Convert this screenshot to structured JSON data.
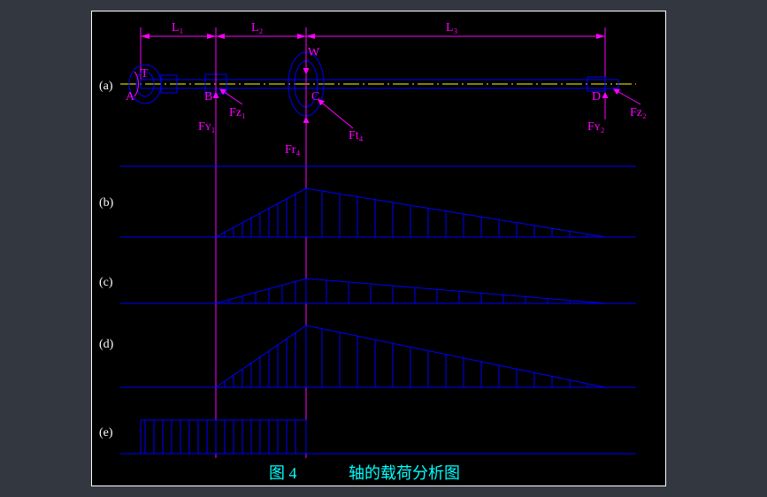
{
  "caption_prefix": "图 4",
  "caption_text": "轴的载荷分析图",
  "dims": {
    "L1": "L₁",
    "L2": "L₂",
    "L3": "L₃"
  },
  "points": {
    "A": "A",
    "B": "B",
    "C": "C",
    "D": "D",
    "T": "T",
    "W": "W"
  },
  "forces": {
    "Fy1": "Fʏ₁",
    "Fz1": "Fz₁",
    "Fr4": "Fr₄",
    "Ft4": "Ft₄",
    "Fy2": "Fʏ₂",
    "Fz2": "Fz₂"
  },
  "rows": {
    "a": "(a)",
    "b": "(b)",
    "c": "(c)",
    "d": "(d)",
    "e": "(e)"
  },
  "chart_data": {
    "type": "diagram",
    "title": "轴的载荷分析图",
    "subplots": [
      "(a)",
      "(b)",
      "(c)",
      "(d)",
      "(e)"
    ],
    "x_stations": {
      "A": 0,
      "B": 0.12,
      "C": 0.27,
      "D": 1.0
    },
    "spans": {
      "L1": [
        "A",
        "B"
      ],
      "L2": [
        "B",
        "C"
      ],
      "L3": [
        "C",
        "D"
      ]
    },
    "applied_forces_at": {
      "B": [
        "Fy1",
        "Fz1"
      ],
      "C": [
        "Fr4",
        "Ft4",
        "W"
      ],
      "D": [
        "Fy2",
        "Fz2"
      ],
      "A": [
        "T"
      ]
    },
    "series": [
      {
        "name": "(b)",
        "desc": "moment diagram 1 (peak at C)",
        "x": [
          0.12,
          0.27,
          1.0
        ],
        "y": [
          0,
          55,
          0
        ]
      },
      {
        "name": "(c)",
        "desc": "moment diagram 2 (peak at C)",
        "x": [
          0.12,
          0.27,
          1.0
        ],
        "y": [
          0,
          28,
          0
        ]
      },
      {
        "name": "(d)",
        "desc": "combined moment (peak at C)",
        "x": [
          0.12,
          0.27,
          1.0
        ],
        "y": [
          0,
          70,
          0
        ]
      },
      {
        "name": "(e)",
        "desc": "torque diagram (constant A–C)",
        "x": [
          0.0,
          0.27
        ],
        "y": [
          38,
          38
        ]
      }
    ]
  }
}
